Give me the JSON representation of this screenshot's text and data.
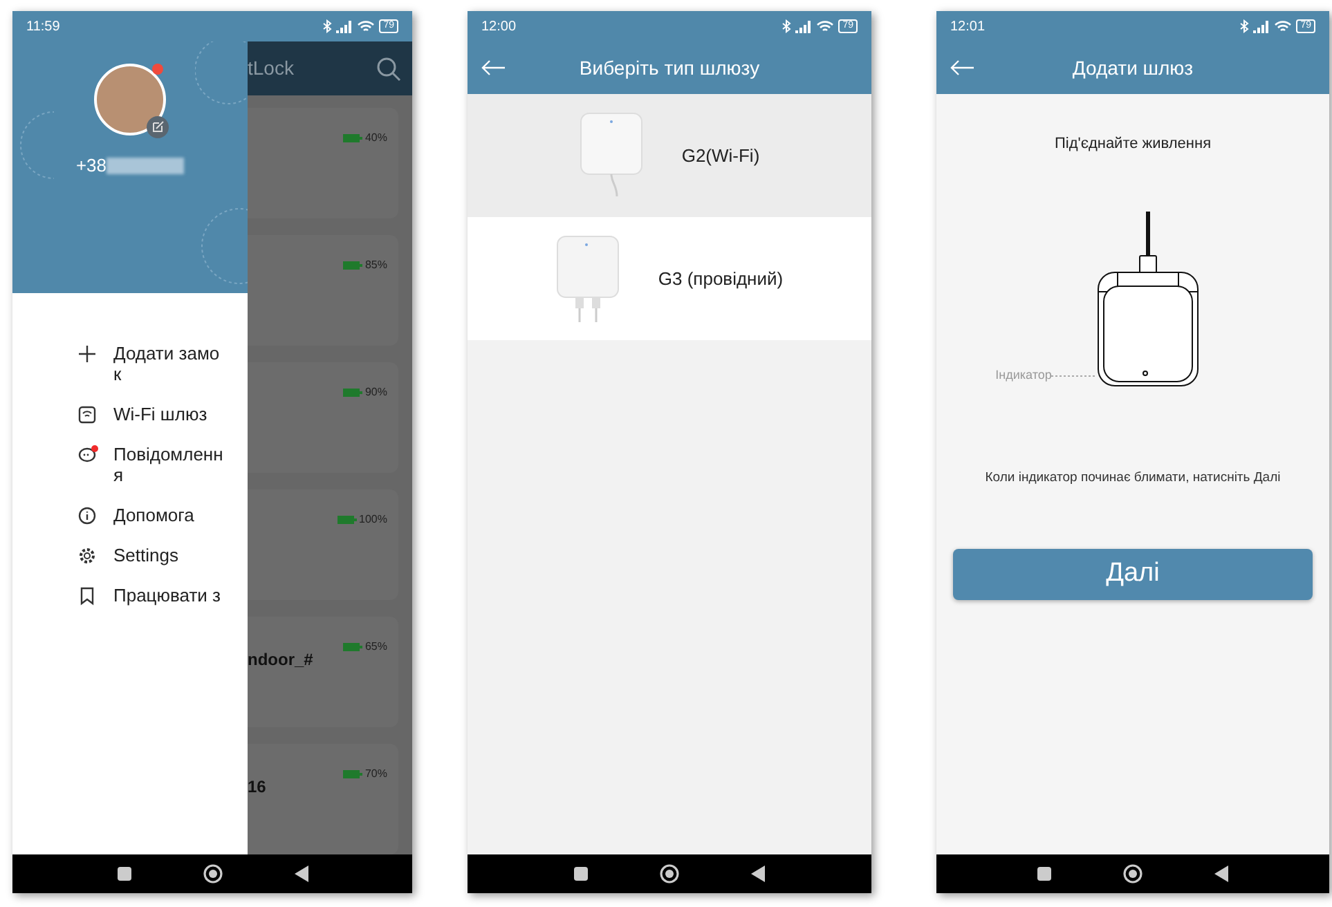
{
  "drawer_screen": {
    "status_bar": {
      "time": "11:59",
      "battery": "79"
    },
    "app_title": "tLock",
    "profile": {
      "phone": "+38",
      "has_notification": true
    },
    "menu_items": [
      {
        "kind": "plus",
        "label": "Додати замок",
        "badge": false
      },
      {
        "kind": "wifi",
        "label": "Wi-Fi шлюз",
        "badge": false
      },
      {
        "kind": "message",
        "label": "Повідомлення",
        "badge": true
      },
      {
        "kind": "info",
        "label": "Допомога",
        "badge": false
      },
      {
        "kind": "settings",
        "label": "Settings",
        "badge": false
      },
      {
        "kind": "bookmark",
        "label": "Працювати з",
        "badge": false
      }
    ],
    "lock_cards": [
      {
        "battery": "40%"
      },
      {
        "battery": "85%"
      },
      {
        "battery": "90%"
      },
      {
        "battery": "100%"
      },
      {
        "name": "ndoor_#",
        "battery": "65%"
      },
      {
        "name": "16",
        "battery": "70%"
      }
    ]
  },
  "gateway_type_screen": {
    "status_bar": {
      "time": "12:00",
      "battery": "79"
    },
    "title": "Виберіть тип шлюзу",
    "options": [
      {
        "kind": "wifi",
        "label": "G2(Wi-Fi)",
        "pressed": true
      },
      {
        "kind": "wired",
        "label": "G3 (провідний)",
        "pressed": false
      }
    ]
  },
  "add_gateway_screen": {
    "status_bar": {
      "time": "12:01",
      "battery": "79"
    },
    "title": "Додати шлюз",
    "step": "Під'єднайте живлення",
    "indicator_label": "Індикатор",
    "instruction": "Коли індикатор починає блимати, натисніть Далі",
    "next_button": "Далі"
  }
}
